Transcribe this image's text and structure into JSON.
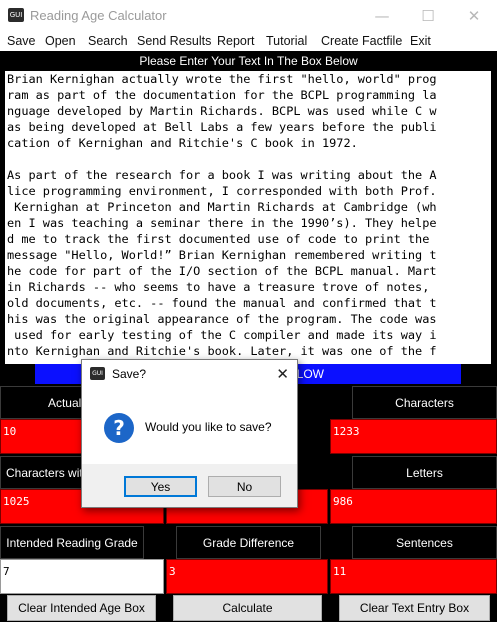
{
  "window": {
    "title": "Reading Age Calculator",
    "app_icon_text": "GUI",
    "minimize": "—",
    "maximize": "☐",
    "close": "✕"
  },
  "menu": [
    "Save",
    "Open",
    "Search",
    "Send Results",
    "Report",
    "Tutorial",
    "Create Factfile",
    "Exit"
  ],
  "prompt": "Please Enter Your Text In The Box Below",
  "text_lines": [
    "Brian Kernighan actually wrote the first \"hello, world\" prog",
    "ram as part of the documentation for the BCPL programming la",
    "nguage developed by Martin Richards. BCPL was used while C w",
    "as being developed at Bell Labs a few years before the publi",
    "cation of Kernighan and Ritchie's C book in 1972.",
    "",
    "As part of the research for a book I was writing about the A",
    "lice programming environment, I corresponded with both Prof.",
    " Kernighan at Princeton and Martin Richards at Cambridge (wh",
    "en I was teaching a seminar there in the 1990’s). They helpe",
    "d me to track the first documented use of code to print the ",
    "message \"Hello, World!” Brian Kernighan remembered writing t",
    "he code for part of the I/O section of the BCPL manual. Mart",
    "in Richards -- who seems to have a treasure trove of notes, ",
    "old documents, etc. -- found the manual and confirmed that t",
    "his was the original appearance of the program. The code was",
    " used for early testing of the C compiler and made its way i",
    "nto Kernighan and Ritchie's book. Later, it was one of the f"
  ],
  "result_bar": "LOW",
  "labels": {
    "actual_reading": "Actual Readi",
    "characters": "Characters",
    "characters_with": "Characters with",
    "letters": "Letters",
    "intended_reading_grade": "Intended Reading Grade",
    "grade_difference": "Grade Difference",
    "sentences": "Sentences"
  },
  "values": {
    "actual_reading": "10",
    "characters": "1233",
    "characters_with": "1025",
    "letters": "986",
    "intended_reading_grade": "7",
    "grade_difference": "3",
    "sentences": "11"
  },
  "buttons": {
    "clear_age": "Clear Intended Age Box",
    "calculate": "Calculate",
    "clear_text": "Clear Text Entry Box"
  },
  "dialog": {
    "title": "Save?",
    "icon_text": "GUI",
    "close": "✕",
    "message": "Would you like to save?",
    "yes": "Yes",
    "no": "No"
  },
  "colors": {
    "accent_blue": "#0b10ff",
    "value_red": "#ff0000",
    "question_blue": "#1c66c8"
  }
}
